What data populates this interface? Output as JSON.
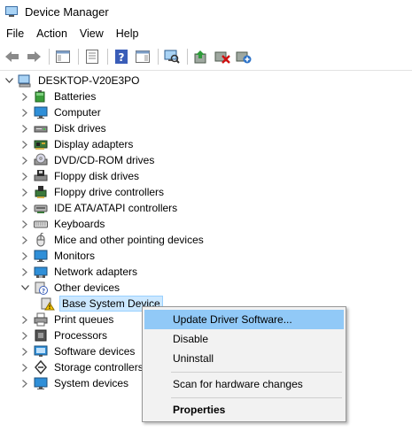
{
  "window": {
    "title": "Device Manager"
  },
  "menu": [
    "File",
    "Action",
    "View",
    "Help"
  ],
  "toolbar": {
    "buttons": [
      "back-icon",
      "forward-icon",
      "show-hide-console-tree-icon",
      "properties-icon",
      "help-icon",
      "show-action-pane-icon",
      "scan-hardware-icon",
      "update-driver-icon",
      "uninstall-device-icon",
      "add-legacy-hardware-icon"
    ]
  },
  "tree": {
    "root": "DESKTOP-V20E3PO",
    "categories": [
      {
        "label": "Batteries",
        "icon": "battery-icon",
        "expanded": false
      },
      {
        "label": "Computer",
        "icon": "computer-icon",
        "expanded": false
      },
      {
        "label": "Disk drives",
        "icon": "disk-drive-icon",
        "expanded": false
      },
      {
        "label": "Display adapters",
        "icon": "display-adapter-icon",
        "expanded": false
      },
      {
        "label": "DVD/CD-ROM drives",
        "icon": "dvd-drive-icon",
        "expanded": false
      },
      {
        "label": "Floppy disk drives",
        "icon": "floppy-drive-icon",
        "expanded": false
      },
      {
        "label": "Floppy drive controllers",
        "icon": "floppy-controller-icon",
        "expanded": false
      },
      {
        "label": "IDE ATA/ATAPI controllers",
        "icon": "ide-controller-icon",
        "expanded": false
      },
      {
        "label": "Keyboards",
        "icon": "keyboard-icon",
        "expanded": false
      },
      {
        "label": "Mice and other pointing devices",
        "icon": "mouse-icon",
        "expanded": false
      },
      {
        "label": "Monitors",
        "icon": "monitor-icon",
        "expanded": false
      },
      {
        "label": "Network adapters",
        "icon": "network-adapter-icon",
        "expanded": false
      },
      {
        "label": "Other devices",
        "icon": "other-devices-icon",
        "expanded": true
      },
      {
        "label": "Base System Device",
        "icon": "warning-device-icon",
        "child": true,
        "selected": true
      },
      {
        "label": "Print queues",
        "icon": "printer-icon",
        "expanded": false
      },
      {
        "label": "Processors",
        "icon": "processor-icon",
        "expanded": false
      },
      {
        "label": "Software devices",
        "icon": "software-device-icon",
        "expanded": false
      },
      {
        "label": "Storage controllers",
        "icon": "storage-controller-icon",
        "expanded": false
      },
      {
        "label": "System devices",
        "icon": "system-device-icon",
        "expanded": false
      }
    ]
  },
  "context_menu": {
    "items": [
      {
        "label": "Update Driver Software...",
        "highlighted": true
      },
      {
        "label": "Disable"
      },
      {
        "label": "Uninstall"
      },
      {
        "separator": true
      },
      {
        "label": "Scan for hardware changes"
      },
      {
        "separator": true
      },
      {
        "label": "Properties",
        "bold": true
      }
    ]
  }
}
